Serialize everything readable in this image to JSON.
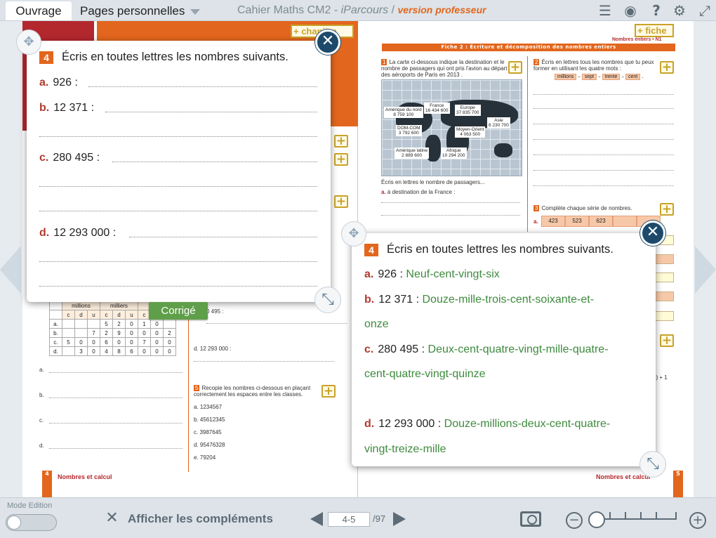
{
  "topbar": {
    "tab_ouvrage": "Ouvrage",
    "tab_pages": "Pages personnelles",
    "title_a": "Cahier Maths CM2",
    "title_sep": " - ",
    "title_i": "iParcours",
    "title_slash": " / ",
    "title_v": "version professeur",
    "icons": [
      "list-icon",
      "eye-icon",
      "help-icon",
      "gear-icon",
      "fullscreen-icon"
    ]
  },
  "book": {
    "chapitre_btn": "+ chapitre",
    "fiche_btn": "+ fiche",
    "fiche_banner": "Fiche 2 : Écriture et décomposition des nombres entiers",
    "fiche_tag": "Nombres entiers • N1",
    "ex1_text": "La carte ci-dessous indique la destination et le nombre de passagers qui ont pris l'avion au départ des aéroports de Paris en 2013 .",
    "map_labels": [
      {
        "name": "Amérique du nord",
        "value": "8 759 100"
      },
      {
        "name": "France",
        "value": "16 434 600"
      },
      {
        "name": "Europe",
        "value": "37 835 700"
      },
      {
        "name": "DOM-COM",
        "value": "3 792 600"
      },
      {
        "name": "Moyen-Orient",
        "value": "4 063 500"
      },
      {
        "name": "Asie",
        "value": "6 230 700"
      },
      {
        "name": "Amérique latine",
        "value": "2 889 600"
      },
      {
        "name": "Afrique",
        "value": "10 294 200"
      }
    ],
    "ex1_question": "Écris en lettres le nombre de passagers...",
    "ex1_a": "à destination de la France :",
    "ex2_text": "Écris en lettres tous les nombres que tu peux former en utilisant les quatre mots :",
    "ex2_words": [
      "millions",
      "sept",
      "trente",
      "cent"
    ],
    "ex3_text": "Complète chaque série de nombres.",
    "ex3_cells": [
      "423",
      "523",
      "623"
    ],
    "table_heads": [
      "millions",
      "milliers"
    ],
    "table_cols": [
      "c",
      "d",
      "u",
      "c",
      "d",
      "u",
      "c",
      "d",
      "u"
    ],
    "table_rows": [
      {
        "l": "a.",
        "v": [
          "",
          "",
          "",
          "5",
          "2",
          "0",
          "1",
          "0",
          ""
        ]
      },
      {
        "l": "b.",
        "v": [
          "",
          "",
          "7",
          "2",
          "9",
          "0",
          "0",
          "0",
          "2"
        ]
      },
      {
        "l": "c.",
        "v": [
          "5",
          "0",
          "0",
          "6",
          "0",
          "0",
          "7",
          "0",
          "0"
        ]
      },
      {
        "l": "d.",
        "v": [
          "",
          "3",
          "0",
          "4",
          "8",
          "6",
          "0",
          "0",
          "0"
        ]
      }
    ],
    "left_c": "0 495 :",
    "left_d": "d. 12 293 000 :",
    "ex5_text": "Recopie les nombres ci-dessous en plaçant correctement les espaces entre les classes.",
    "ex5_items": [
      "a. 1234567",
      "b. 45612345",
      "c. 3987645",
      "d. 95476328",
      "e. 79204"
    ],
    "left_footer_num": "4",
    "left_footer": "Nombres et calcul",
    "right_footer_num": "5",
    "right_footer": "Nombres et calcul",
    "right_side_text": "0) + 1"
  },
  "popup1": {
    "num": "4",
    "title": "Écris en toutes lettres les nombres suivants.",
    "a_label": "a.",
    "a_num": "926 :",
    "b_label": "b.",
    "b_num": "12 371 :",
    "c_label": "c.",
    "c_num": "280 495 :",
    "d_label": "d.",
    "d_num": "12 293 000 :"
  },
  "corrige_btn": "Corrigé",
  "popup2": {
    "num": "4",
    "title": "Écris en toutes lettres les nombres suivants.",
    "a_label": "a.",
    "a_num": "926 :",
    "a_ans": "Neuf-cent-vingt-six",
    "b_label": "b.",
    "b_num": "12 371 :",
    "b_ans1": "Douze-mille-trois-cent-soixante-et-",
    "b_ans2": "onze",
    "c_label": "c.",
    "c_num": "280 495 :",
    "c_ans1": "Deux-cent-quatre-vingt-mille-quatre-",
    "c_ans2": "cent-quatre-vingt-quinze",
    "d_label": "d.",
    "d_num": "12 293 000 :",
    "d_ans1": "Douze-millions-deux-cent-quatre-",
    "d_ans2": "vingt-treize-mille"
  },
  "bottombar": {
    "mode_label": "Mode Edition",
    "afficher": "Afficher les compléments",
    "page_current": "4-5",
    "page_total": "/97"
  }
}
